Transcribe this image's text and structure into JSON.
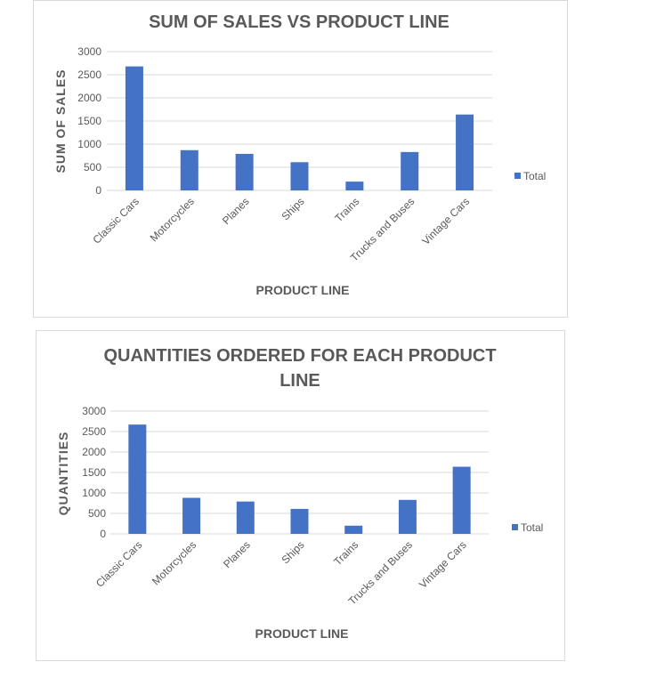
{
  "chart_data": [
    {
      "type": "bar",
      "title": "SUM OF SALES VS PRODUCT LINE",
      "xlabel": "PRODUCT LINE",
      "ylabel": "SUM OF SALES",
      "ylim": [
        0,
        3000
      ],
      "yticks": [
        0,
        500,
        1000,
        1500,
        2000,
        2500,
        3000
      ],
      "categories": [
        "Classic Cars",
        "Motorcycles",
        "Planes",
        "Ships",
        "Trains",
        "Trucks and Buses",
        "Vintage Cars"
      ],
      "series": [
        {
          "name": "Total",
          "values": [
            2680,
            870,
            790,
            610,
            190,
            830,
            1640
          ]
        }
      ],
      "grid": true,
      "legend": "right",
      "color": "#4472c4"
    },
    {
      "type": "bar",
      "title": [
        "QUANTITIES ORDERED FOR EACH PRODUCT",
        "LINE"
      ],
      "xlabel": "PRODUCT LINE",
      "ylabel": "QUANTITIES",
      "ylim": [
        0,
        3000
      ],
      "yticks": [
        0,
        500,
        1000,
        1500,
        2000,
        2500,
        3000
      ],
      "categories": [
        "Classic Cars",
        "Motorcycles",
        "Planes",
        "Ships",
        "Trains",
        "Trucks and Buses",
        "Vintage Cars"
      ],
      "series": [
        {
          "name": "Total",
          "values": [
            2670,
            880,
            790,
            610,
            200,
            830,
            1640
          ]
        }
      ],
      "grid": true,
      "legend": "right",
      "color": "#4472c4"
    }
  ]
}
